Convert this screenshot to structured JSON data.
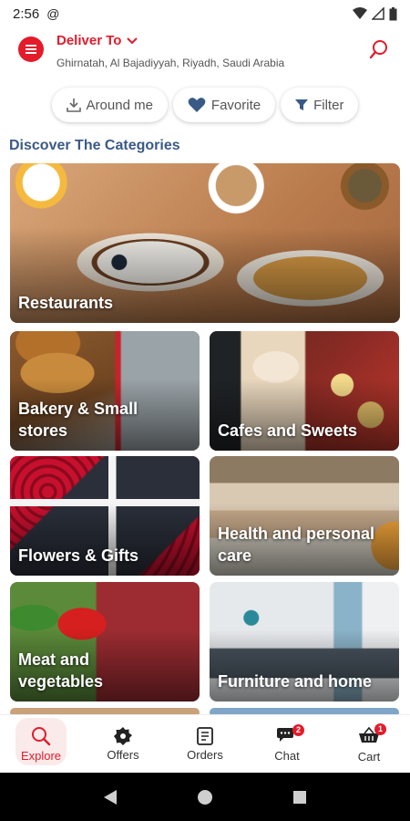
{
  "status": {
    "time": "2:56"
  },
  "header": {
    "deliver_to": "Deliver To",
    "address": "Ghirnatah, Al Bajadiyyah, Riyadh, Saudi Arabia"
  },
  "chips": [
    {
      "label": "Around me",
      "icon": "download-pin-icon"
    },
    {
      "label": "Favorite",
      "icon": "heart-icon"
    },
    {
      "label": "Filter",
      "icon": "filter-icon"
    }
  ],
  "section_title": "Discover The Categories",
  "categories": [
    {
      "label": "Restaurants"
    },
    {
      "label": "Bakery & Small\nstores"
    },
    {
      "label": "Cafes and Sweets"
    },
    {
      "label": "Flowers & Gifts"
    },
    {
      "label": "Health and personal\ncare"
    },
    {
      "label": "Meat and\nvegetables"
    },
    {
      "label": "Furniture and home"
    }
  ],
  "nav": [
    {
      "label": "Explore",
      "icon": "search-icon",
      "active": true
    },
    {
      "label": "Offers",
      "icon": "gear-badge-icon"
    },
    {
      "label": "Orders",
      "icon": "receipt-icon"
    },
    {
      "label": "Chat",
      "icon": "chat-icon",
      "badge": "2"
    },
    {
      "label": "Cart",
      "icon": "cart-icon",
      "badge": "1"
    }
  ],
  "colors": {
    "brand": "#e31b2b",
    "section_title": "#3a5a86"
  }
}
